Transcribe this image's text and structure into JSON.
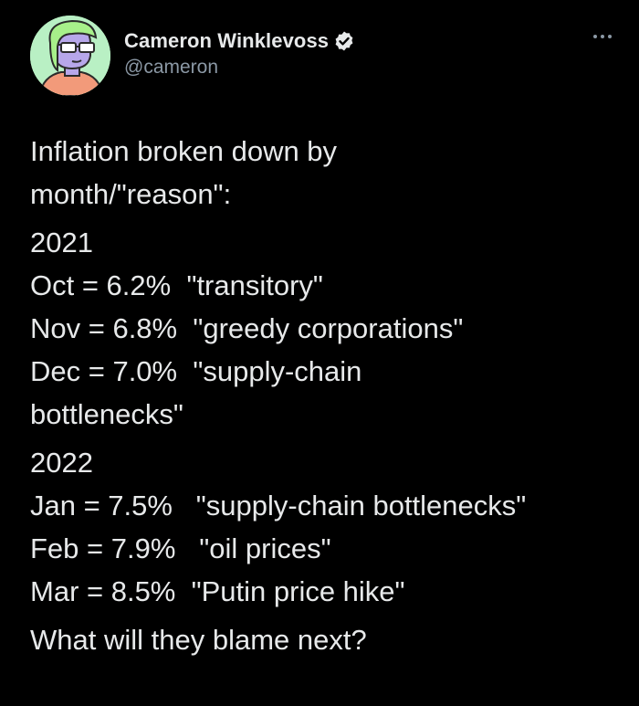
{
  "author": {
    "display_name": "Cameron Winklevoss",
    "handle": "@cameron",
    "verified": true,
    "avatar_icon": "cartoon-avatar-icon",
    "verified_icon": "verified-badge-icon"
  },
  "menu": {
    "icon": "more-dots-icon"
  },
  "tweet": {
    "intro": [
      "Inflation broken down by",
      "month/\"reason\":"
    ],
    "year_2021": "2021",
    "lines_2021": [
      "Oct = 6.2%  \"transitory\"",
      "Nov = 6.8%  \"greedy corporations\"",
      "Dec = 7.0%  \"supply-chain",
      "bottlenecks\""
    ],
    "year_2022": "2022",
    "lines_2022": [
      "Jan = 7.5%   \"supply-chain bottlenecks\"",
      "Feb = 7.9%   \"oil prices\"",
      "Mar = 8.5%  \"Putin price hike\""
    ],
    "closing": "What will they blame next?"
  },
  "colors": {
    "background": "#000000",
    "text": "#e7e9ea",
    "secondary_text": "#8b98a5",
    "avatar_bg": "#b9f0c4"
  }
}
